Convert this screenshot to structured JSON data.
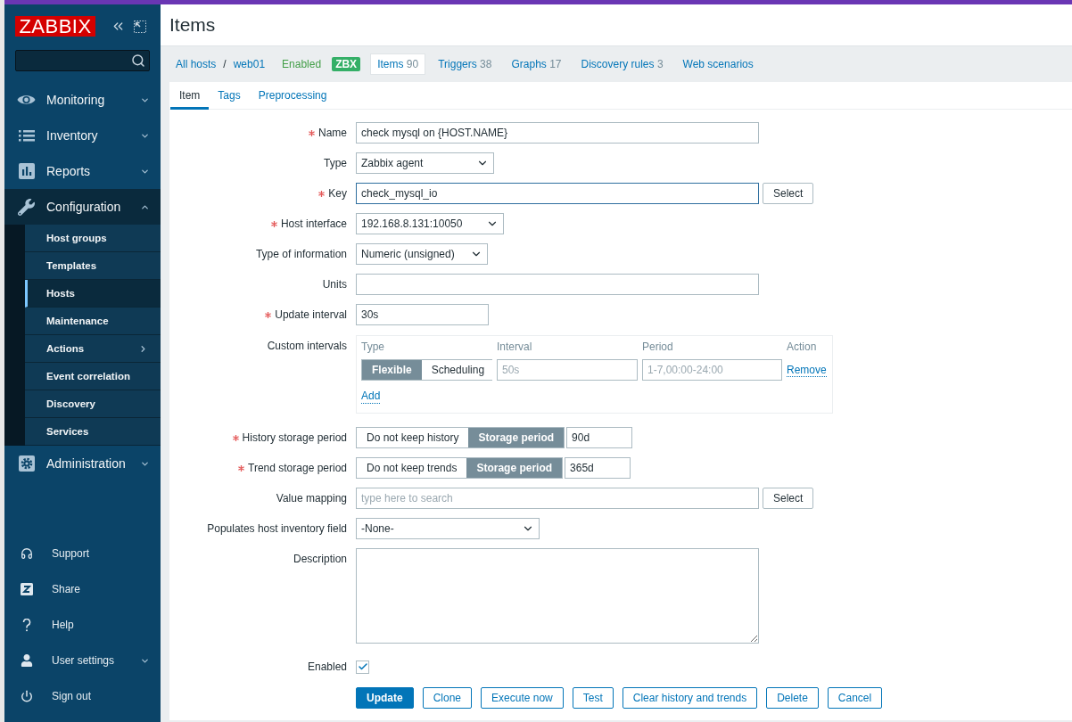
{
  "sidebar": {
    "logo": "ZABBIX",
    "menu": [
      {
        "label": "Monitoring",
        "expanded": false
      },
      {
        "label": "Inventory",
        "expanded": false
      },
      {
        "label": "Reports",
        "expanded": false
      },
      {
        "label": "Configuration",
        "expanded": true,
        "children": [
          {
            "label": "Host groups",
            "kind": "link",
            "selected": false
          },
          {
            "label": "Templates",
            "kind": "link",
            "selected": false
          },
          {
            "label": "Hosts",
            "kind": "link",
            "selected": true
          },
          {
            "label": "Maintenance",
            "kind": "link",
            "selected": false
          },
          {
            "label": "Actions",
            "kind": "submenu",
            "selected": false
          },
          {
            "label": "Event correlation",
            "kind": "link",
            "selected": false
          },
          {
            "label": "Discovery",
            "kind": "link",
            "selected": false
          },
          {
            "label": "Services",
            "kind": "link",
            "selected": false
          }
        ]
      },
      {
        "label": "Administration",
        "expanded": false
      }
    ],
    "footer": [
      {
        "label": "Support",
        "kind": "link"
      },
      {
        "label": "Share",
        "kind": "link"
      },
      {
        "label": "Help",
        "kind": "link"
      },
      {
        "label": "User settings",
        "kind": "submenu"
      },
      {
        "label": "Sign out",
        "kind": "link"
      }
    ]
  },
  "header": {
    "title": "Items"
  },
  "host_nav": {
    "breadcrumbs": [
      {
        "label": "All hosts"
      },
      {
        "label": "web01"
      }
    ],
    "separator": "/",
    "status": "Enabled",
    "interfaces": [
      {
        "label": "ZBX",
        "available": true
      }
    ],
    "tabs": [
      {
        "label": "Items",
        "count": "90",
        "selected": true
      },
      {
        "label": "Triggers",
        "count": "38",
        "selected": false
      },
      {
        "label": "Graphs",
        "count": "17",
        "selected": false
      },
      {
        "label": "Discovery rules",
        "count": "3",
        "selected": false
      },
      {
        "label": "Web scenarios",
        "selected": false
      }
    ]
  },
  "form_tabs": [
    {
      "label": "Item",
      "selected": true
    },
    {
      "label": "Tags",
      "selected": false
    },
    {
      "label": "Preprocessing",
      "selected": false
    }
  ],
  "form": {
    "name": {
      "label": "Name",
      "required": true,
      "value": "check mysql on {HOST.NAME}"
    },
    "type": {
      "label": "Type",
      "required": false,
      "value": "Zabbix agent"
    },
    "key": {
      "label": "Key",
      "required": true,
      "value": "check_mysql_io",
      "focused": true,
      "button": "Select"
    },
    "host_interface": {
      "label": "Host interface",
      "required": true,
      "value": "192.168.8.131:10050"
    },
    "type_of_information": {
      "label": "Type of information",
      "required": false,
      "value": "Numeric (unsigned)"
    },
    "units": {
      "label": "Units",
      "required": false
    },
    "update_interval": {
      "label": "Update interval",
      "required": true,
      "value": "30s"
    },
    "custom_intervals": {
      "label": "Custom intervals",
      "required": false,
      "columns": [
        "Type",
        "Interval",
        "Period",
        "Action"
      ],
      "rows": [
        {
          "type_options": [
            {
              "label": "Flexible",
              "selected": true
            },
            {
              "label": "Scheduling",
              "selected": false
            }
          ],
          "interval": {
            "placeholder": "50s"
          },
          "period": {
            "placeholder": "1-7,00:00-24:00"
          },
          "action": "Remove"
        }
      ],
      "add": "Add"
    },
    "history_storage_period": {
      "label": "History storage period",
      "required": true,
      "options": [
        {
          "label": "Do not keep history",
          "selected": false
        },
        {
          "label": "Storage period",
          "selected": true
        }
      ],
      "value": "90d"
    },
    "trend_storage_period": {
      "label": "Trend storage period",
      "required": true,
      "options": [
        {
          "label": "Do not keep trends",
          "selected": false
        },
        {
          "label": "Storage period",
          "selected": true
        }
      ],
      "value": "365d"
    },
    "value_mapping": {
      "label": "Value mapping",
      "required": false,
      "placeholder": "type here to search",
      "button": "Select"
    },
    "inventory_field": {
      "label": "Populates host inventory field",
      "required": false,
      "value": "-None-"
    },
    "description": {
      "label": "Description",
      "required": false
    },
    "enabled": {
      "label": "Enabled",
      "checked": true
    }
  },
  "buttons": [
    {
      "label": "Update",
      "primary": true
    },
    {
      "label": "Clone",
      "primary": false
    },
    {
      "label": "Execute now",
      "primary": false
    },
    {
      "label": "Test",
      "primary": false
    },
    {
      "label": "Clear history and trends",
      "primary": false
    },
    {
      "label": "Delete",
      "primary": false
    },
    {
      "label": "Cancel",
      "primary": false
    }
  ]
}
